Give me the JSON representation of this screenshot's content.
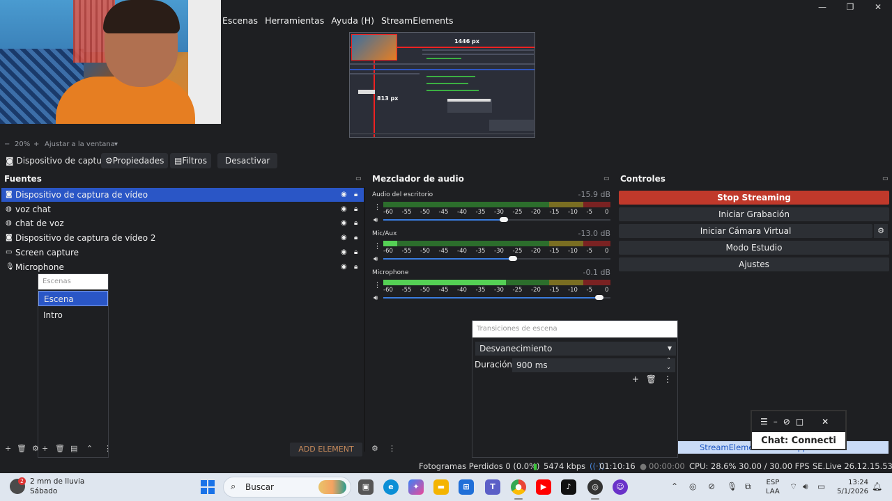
{
  "menu": [
    "Escenas",
    "Herramientas",
    "Ayuda (H)",
    "StreamElements"
  ],
  "preview": {
    "width_label": "1446 px",
    "height_label": "813 px"
  },
  "zoom": {
    "minus": "−",
    "value": "20%",
    "plus": "+",
    "fit": "Ajustar a la ventana"
  },
  "source_toolbar": {
    "selected_source": "Dispositivo de captur",
    "properties": "Propiedades",
    "filters": "Filtros",
    "deactivate": "Desactivar"
  },
  "sources": {
    "title": "Fuentes",
    "items": [
      {
        "name": "Dispositivo de captura de vídeo",
        "icon": "camera-icon"
      },
      {
        "name": "voz chat",
        "icon": "globe-icon"
      },
      {
        "name": "chat de voz",
        "icon": "globe-icon"
      },
      {
        "name": "Dispositivo de captura de vídeo 2",
        "icon": "camera-icon"
      },
      {
        "name": "Screen capture",
        "icon": "monitor-icon"
      },
      {
        "name": "Microphone",
        "icon": "mic-icon"
      }
    ]
  },
  "scenes": {
    "title": "Escenas",
    "items": [
      "Escena",
      "Intro"
    ]
  },
  "add_element": "ADD ELEMENT",
  "mixer": {
    "title": "Mezclador de audio",
    "scale": [
      "-60",
      "-55",
      "-50",
      "-45",
      "-40",
      "-35",
      "-30",
      "-25",
      "-20",
      "-15",
      "-10",
      "-5",
      "0"
    ],
    "channels": [
      {
        "name": "Audio del escritorio",
        "db": "-15.9 dB",
        "level": 0.0,
        "volume": 0.55
      },
      {
        "name": "Mic/Aux",
        "db": "-13.0 dB",
        "level": 0.06,
        "volume": 0.59
      },
      {
        "name": "Microphone",
        "db": "-0.1 dB",
        "level": 0.54,
        "volume": 0.97
      }
    ]
  },
  "controls": {
    "title": "Controles",
    "stop_streaming": "Stop Streaming",
    "start_recording": "Iniciar Grabación",
    "virtual_cam": "Iniciar Cámara Virtual",
    "studio_mode": "Modo Estudio",
    "settings": "Ajustes"
  },
  "transitions": {
    "title": "Transiciones de escena",
    "selected": "Desvanecimiento",
    "duration_label": "Duración",
    "duration_value": "900 ms"
  },
  "streamelements": {
    "chat": "Chat: Connecti",
    "support": "StreamElements Live Support"
  },
  "status": {
    "dropped": "Fotogramas Perdidos 0 (0.0%)",
    "bitrate": "5474 kbps",
    "stream_time": "01:10:16",
    "rec_time": "00:00:00",
    "cpu": "CPU: 28.6%",
    "fps": "30.00 / 30.00 FPS",
    "se_version": "SE.Live 26.12.15.535"
  },
  "taskbar": {
    "weather_line1": "2 mm de lluvia",
    "weather_line2": "Sábado",
    "weather_badge": "2",
    "search": "Buscar",
    "lang1": "ESP",
    "lang2": "LAA",
    "time": "13:24",
    "date": "5/1/2026"
  }
}
